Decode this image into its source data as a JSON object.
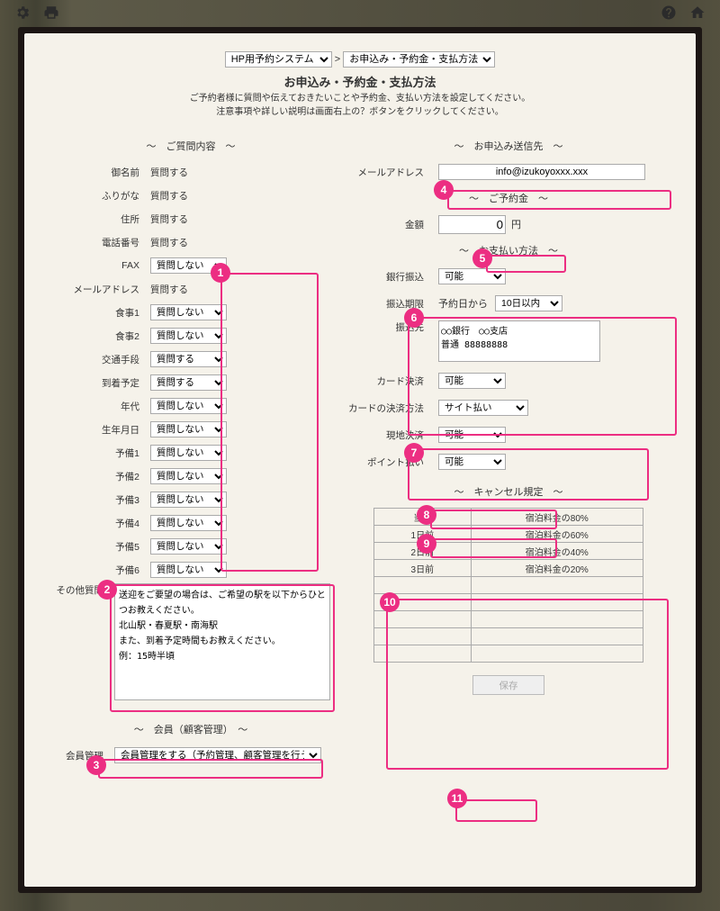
{
  "breadcrumb": {
    "system": "HP用予約システム",
    "page": "お申込み・予約金・支払方法",
    "sep": ">"
  },
  "title": "お申込み・予約金・支払方法",
  "desc_line1": "ご予約者様に質問や伝えておきたいことや予約金、支払い方法を設定してください。",
  "desc_line2": "注意事項や詳しい説明は画面右上の？ボタンをクリックしてください。",
  "sections": {
    "questions": "～　ご質問内容　～",
    "member": "～　会員（顧客管理）　～",
    "send_to": "～　お申込み送信先　～",
    "deposit": "～　ご予約金　～",
    "payment": "～　お支払い方法　～",
    "cancel": "～　キャンセル規定　～"
  },
  "question_items": [
    {
      "label": "御名前",
      "type": "text",
      "value": "質問する"
    },
    {
      "label": "ふりがな",
      "type": "text",
      "value": "質問する"
    },
    {
      "label": "住所",
      "type": "text",
      "value": "質問する"
    },
    {
      "label": "電話番号",
      "type": "text",
      "value": "質問する"
    },
    {
      "label": "FAX",
      "type": "select",
      "value": "質問しない"
    },
    {
      "label": "メールアドレス",
      "type": "text",
      "value": "質問する"
    },
    {
      "label": "食事1",
      "type": "select",
      "value": "質問しない"
    },
    {
      "label": "食事2",
      "type": "select",
      "value": "質問しない"
    },
    {
      "label": "交通手段",
      "type": "select",
      "value": "質問する"
    },
    {
      "label": "到着予定",
      "type": "select",
      "value": "質問する"
    },
    {
      "label": "年代",
      "type": "select",
      "value": "質問しない"
    },
    {
      "label": "生年月日",
      "type": "select",
      "value": "質問しない"
    },
    {
      "label": "予備1",
      "type": "select",
      "value": "質問しない"
    },
    {
      "label": "予備2",
      "type": "select",
      "value": "質問しない"
    },
    {
      "label": "予備3",
      "type": "select",
      "value": "質問しない"
    },
    {
      "label": "予備4",
      "type": "select",
      "value": "質問しない"
    },
    {
      "label": "予備5",
      "type": "select",
      "value": "質問しない"
    },
    {
      "label": "予備6",
      "type": "select",
      "value": "質問しない"
    }
  ],
  "other_q_label": "その他質問",
  "other_q_text": "送迎をご要望の場合は、ご希望の駅を以下からひとつお教えください。\n北山駅・春夏駅・南海駅\nまた、到着予定時間もお教えください。\n例：15時半頃",
  "member_label": "会員管理",
  "member_value": "会員管理をする（予約管理、顧客管理を行う）",
  "send_to_label": "メールアドレス",
  "send_to_value": "info@izukoyoxxx.xxx",
  "deposit_label": "金額",
  "deposit_value": "0",
  "deposit_unit": "円",
  "payment": {
    "bank_label": "銀行振込",
    "bank_value": "可能",
    "due_label": "振込期限",
    "due_prefix": "予約日から",
    "due_value": "10日以内",
    "dest_label": "振込先",
    "dest_value": "○○銀行　○○支店\n普通 88888888",
    "card_label": "カード決済",
    "card_value": "可能",
    "card_method_label": "カードの決済方法",
    "card_method_value": "サイト払い",
    "onsite_label": "現地決済",
    "onsite_value": "可能",
    "point_label": "ポイント払い",
    "point_value": "可能"
  },
  "cancel_rows": [
    {
      "when": "当日",
      "fee": "宿泊料金の80%"
    },
    {
      "when": "1日前",
      "fee": "宿泊料金の60%"
    },
    {
      "when": "2日前",
      "fee": "宿泊料金の40%"
    },
    {
      "when": "3日前",
      "fee": "宿泊料金の20%"
    }
  ],
  "save_label": "保存",
  "badges": [
    "1",
    "2",
    "3",
    "4",
    "5",
    "6",
    "7",
    "8",
    "9",
    "10",
    "11"
  ]
}
